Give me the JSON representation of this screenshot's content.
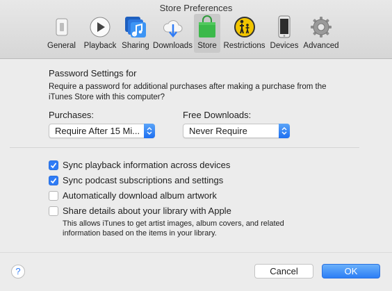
{
  "window": {
    "title": "Store Preferences"
  },
  "toolbar": {
    "items": [
      {
        "label": "General",
        "icon": "general-switch-icon"
      },
      {
        "label": "Playback",
        "icon": "play-icon"
      },
      {
        "label": "Sharing",
        "icon": "music-note-icon"
      },
      {
        "label": "Downloads",
        "icon": "cloud-download-icon"
      },
      {
        "label": "Store",
        "icon": "shopping-bag-icon",
        "active": true
      },
      {
        "label": "Restrictions",
        "icon": "parental-restrictions-icon"
      },
      {
        "label": "Devices",
        "icon": "phone-icon"
      },
      {
        "label": "Advanced",
        "icon": "gear-icon"
      }
    ]
  },
  "password": {
    "heading": "Password Settings for",
    "description": "Require a password for additional purchases after making a purchase from the iTunes Store with this computer?",
    "purchases_label": "Purchases:",
    "purchases_value": "Require After 15 Mi...",
    "free_label": "Free Downloads:",
    "free_value": "Never Require"
  },
  "options": [
    {
      "label": "Sync playback information across devices",
      "checked": true
    },
    {
      "label": "Sync podcast subscriptions and settings",
      "checked": true
    },
    {
      "label": "Automatically download album artwork",
      "checked": false
    },
    {
      "label": "Share details about your library with Apple",
      "checked": false
    }
  ],
  "share_note": "This allows iTunes to get artist images, album covers, and related information based on the items in your library.",
  "buttons": {
    "help": "?",
    "cancel": "Cancel",
    "ok": "OK"
  },
  "colors": {
    "accent": "#2f7cf6",
    "store_green": "#3cb94a"
  }
}
